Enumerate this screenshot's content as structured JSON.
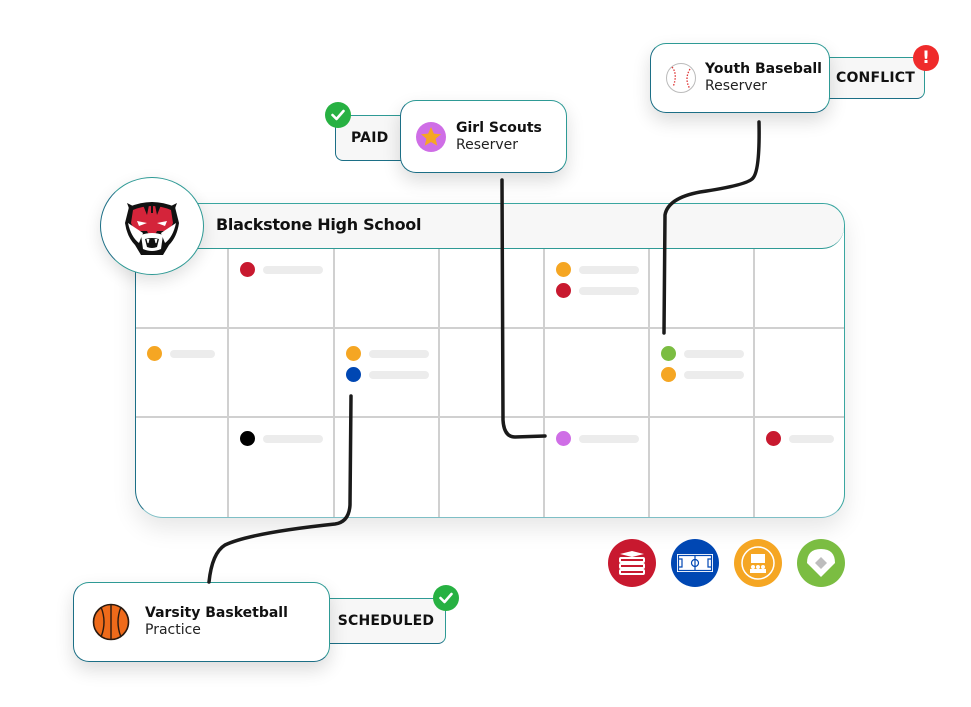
{
  "calendar": {
    "school_name": "Blackstone High School",
    "logo_icon": "tiger-mascot-icon",
    "events": [
      {
        "row": 0,
        "col": 1,
        "color": "#c8192f"
      },
      {
        "row": 0,
        "col": 4,
        "color": "#f5a623"
      },
      {
        "row": 0,
        "col": 4,
        "color": "#c8192f"
      },
      {
        "row": 1,
        "col": 0,
        "color": "#f5a623"
      },
      {
        "row": 1,
        "col": 2,
        "color": "#f5a623"
      },
      {
        "row": 1,
        "col": 2,
        "color": "#0047b3"
      },
      {
        "row": 1,
        "col": 5,
        "color": "#7bbd42"
      },
      {
        "row": 1,
        "col": 5,
        "color": "#f5a623"
      },
      {
        "row": 2,
        "col": 1,
        "color": "#000000"
      },
      {
        "row": 2,
        "col": 4,
        "color": "#cf6ee6"
      },
      {
        "row": 2,
        "col": 6,
        "color": "#c8192f"
      }
    ]
  },
  "callouts": {
    "youth_baseball": {
      "title": "Youth Baseball",
      "subtitle": "Reserver",
      "icon": "baseball-icon",
      "status": "CONFLICT",
      "status_badge": "!",
      "status_color": "#ef2b2b"
    },
    "girl_scouts": {
      "title": "Girl Scouts",
      "subtitle": "Reserver",
      "icon": "star-icon",
      "status": "PAID",
      "status_color": "#27b142"
    },
    "varsity_basketball": {
      "title": "Varsity Basketball",
      "subtitle": "Practice",
      "icon": "basketball-icon",
      "status": "SCHEDULED",
      "status_color": "#27b142"
    }
  },
  "facilities": [
    {
      "name": "library-icon",
      "color": "#c8192f"
    },
    {
      "name": "basketball-court-icon",
      "color": "#0047b3"
    },
    {
      "name": "auditorium-icon",
      "color": "#f5a623"
    },
    {
      "name": "baseball-field-icon",
      "color": "#7bbd42"
    }
  ],
  "colors": {
    "accent_teal": "#2e9a95",
    "accent_dark_teal": "#1c6f86",
    "red": "#c8192f",
    "orange": "#f5a623",
    "blue": "#0047b3",
    "green": "#7bbd42",
    "purple": "#cf6ee6",
    "success": "#27b142",
    "danger": "#ef2b2b"
  }
}
